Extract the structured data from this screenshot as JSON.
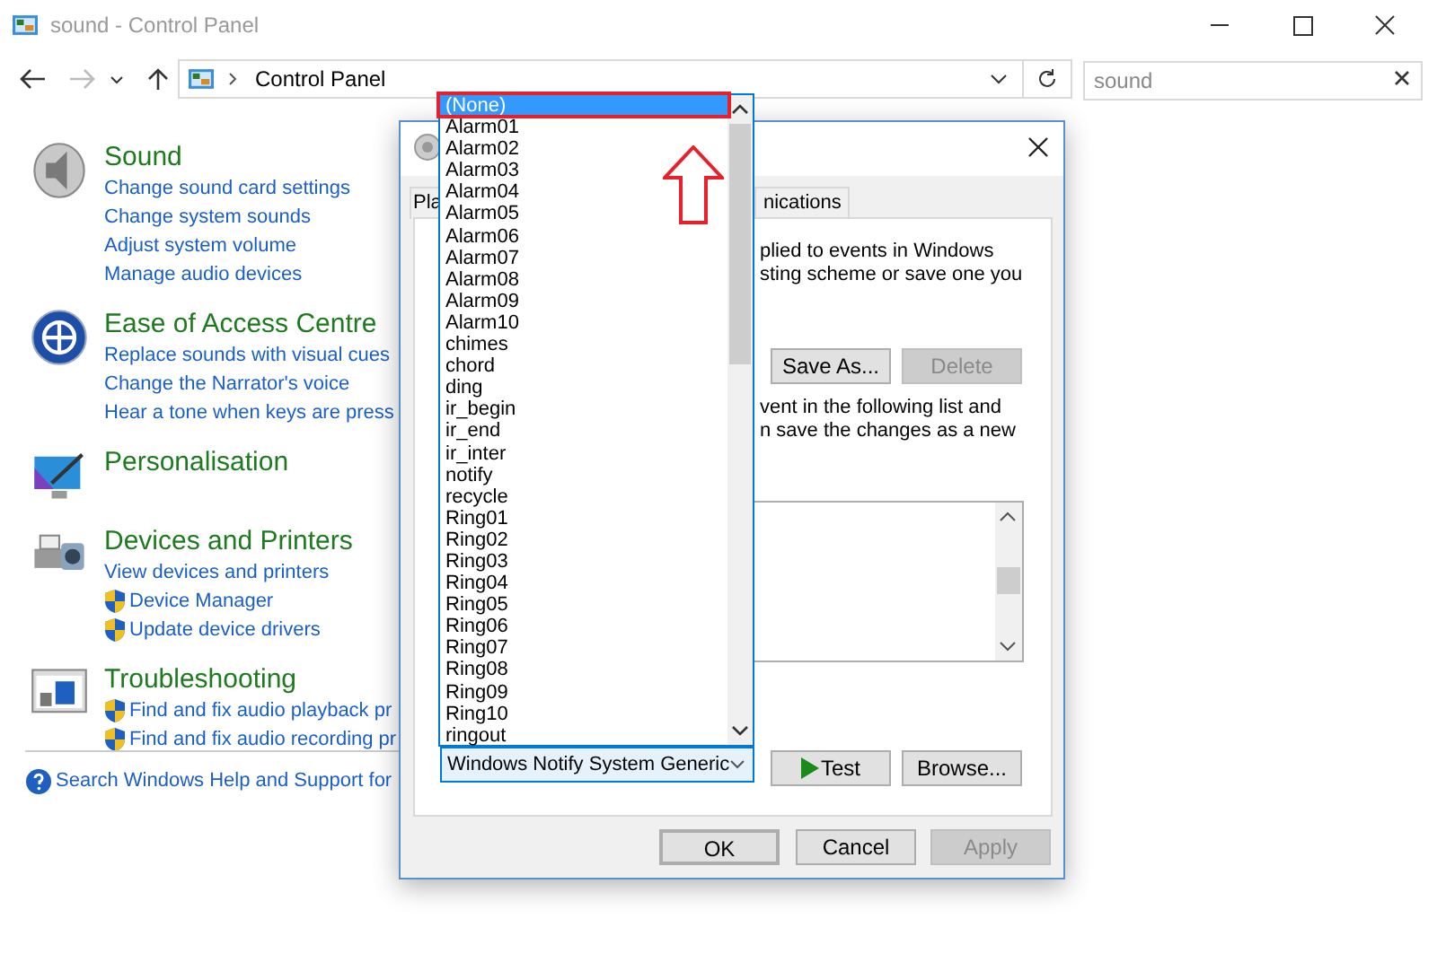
{
  "window": {
    "title": "sound - Control Panel"
  },
  "address": {
    "path": "Control Panel"
  },
  "search": {
    "value": "sound"
  },
  "sections": [
    {
      "kind": "sound",
      "title": "Sound",
      "links": [
        {
          "text": "Change sound card settings",
          "shield": false
        },
        {
          "text": "Change system sounds",
          "shield": false
        },
        {
          "text": "Adjust system volume",
          "shield": false
        },
        {
          "text": "Manage audio devices",
          "shield": false
        }
      ]
    },
    {
      "kind": "access",
      "title": "Ease of Access Centre",
      "links": [
        {
          "text": "Replace sounds with visual cues",
          "shield": false
        },
        {
          "text": "Change the Narrator's voice",
          "shield": false
        },
        {
          "text": "Hear a tone when keys are press",
          "shield": false
        }
      ]
    },
    {
      "kind": "personalisation",
      "title": "Personalisation"
    },
    {
      "kind": "devices",
      "title": "Devices and Printers",
      "links": [
        {
          "text": "View devices and printers",
          "shield": false
        },
        {
          "text": "Device Manager",
          "shield": true
        },
        {
          "text": "Update device drivers",
          "shield": true
        }
      ]
    },
    {
      "kind": "troubleshooting",
      "title": "Troubleshooting",
      "links": [
        {
          "text": "Find and fix audio playback pr",
          "shield": true
        },
        {
          "text": "Find and fix audio recording pr",
          "shield": true
        }
      ]
    }
  ],
  "help_link": "Search Windows Help and Support for",
  "dialog": {
    "tabs": [
      {
        "label": "Pla",
        "selected": false
      },
      {
        "label": "nications",
        "selected": false
      }
    ],
    "text_1": [
      "plied to events in Windows",
      "sting scheme or save one you"
    ],
    "scheme_buttons": [
      {
        "label": "Save As...",
        "disabled": false
      },
      {
        "label": "Delete",
        "disabled": true
      }
    ],
    "text_2": [
      "vent in the following list and",
      "n save the changes as a new"
    ],
    "sound_buttons": [
      {
        "label": "Test",
        "kind": "play"
      },
      {
        "label": "Browse...",
        "kind": "plain"
      }
    ],
    "footer_buttons": [
      {
        "label": "OK",
        "disabled": false,
        "default": true
      },
      {
        "label": "Cancel",
        "disabled": false,
        "default": false
      },
      {
        "label": "Apply",
        "disabled": true,
        "default": false
      }
    ]
  },
  "sound_dropdown": {
    "value": "Windows Notify System Generic",
    "items": [
      {
        "label": "(None)",
        "selected": true
      },
      {
        "label": "Alarm01",
        "selected": false
      },
      {
        "label": "Alarm02",
        "selected": false
      },
      {
        "label": "Alarm03",
        "selected": false
      },
      {
        "label": "Alarm04",
        "selected": false
      },
      {
        "label": "Alarm05",
        "selected": false
      },
      {
        "label": "Alarm06",
        "selected": false
      },
      {
        "label": "Alarm07",
        "selected": false
      },
      {
        "label": "Alarm08",
        "selected": false
      },
      {
        "label": "Alarm09",
        "selected": false
      },
      {
        "label": "Alarm10",
        "selected": false
      },
      {
        "label": "chimes",
        "selected": false
      },
      {
        "label": "chord",
        "selected": false
      },
      {
        "label": "ding",
        "selected": false
      },
      {
        "label": "ir_begin",
        "selected": false
      },
      {
        "label": "ir_end",
        "selected": false
      },
      {
        "label": "ir_inter",
        "selected": false
      },
      {
        "label": "notify",
        "selected": false
      },
      {
        "label": "recycle",
        "selected": false
      },
      {
        "label": "Ring01",
        "selected": false
      },
      {
        "label": "Ring02",
        "selected": false
      },
      {
        "label": "Ring03",
        "selected": false
      },
      {
        "label": "Ring04",
        "selected": false
      },
      {
        "label": "Ring05",
        "selected": false
      },
      {
        "label": "Ring06",
        "selected": false
      },
      {
        "label": "Ring07",
        "selected": false
      },
      {
        "label": "Ring08",
        "selected": false
      },
      {
        "label": "Ring09",
        "selected": false
      },
      {
        "label": "Ring10",
        "selected": false
      },
      {
        "label": "ringout",
        "selected": false
      }
    ]
  }
}
